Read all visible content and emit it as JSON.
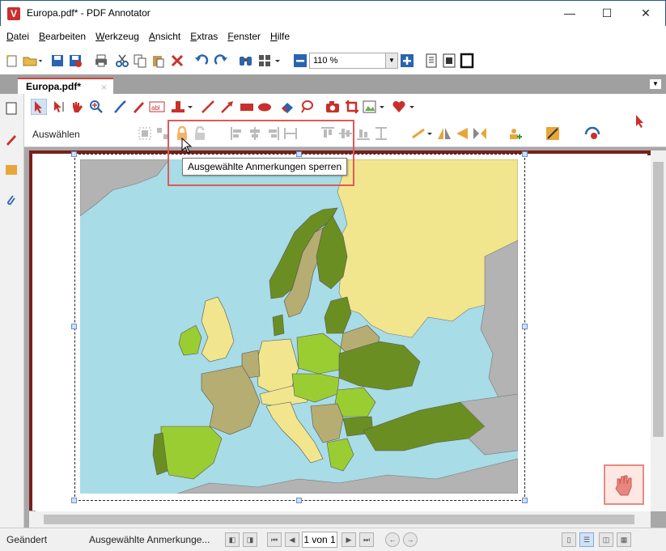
{
  "window": {
    "title": "Europa.pdf* - PDF Annotator",
    "minimize": "—",
    "maximize": "☐",
    "close": "✕"
  },
  "menu": [
    "Datei",
    "Bearbeiten",
    "Werkzeug",
    "Ansicht",
    "Extras",
    "Fenster",
    "Hilfe"
  ],
  "toolbar": {
    "zoom_value": "110 %"
  },
  "tab": {
    "label": "Europa.pdf*",
    "close": "×"
  },
  "ribbon": {
    "mode_label": "Auswählen"
  },
  "tooltip": {
    "text": "Ausgewählte Anmerkungen sperren"
  },
  "status": {
    "state": "Geändert",
    "hint": "Ausgewählte Anmerkunge...",
    "page": "1 von 1"
  },
  "colors": {
    "accent": "#c9302c",
    "sea": "#a8dce6",
    "land_gray": "#b3b3b3"
  }
}
